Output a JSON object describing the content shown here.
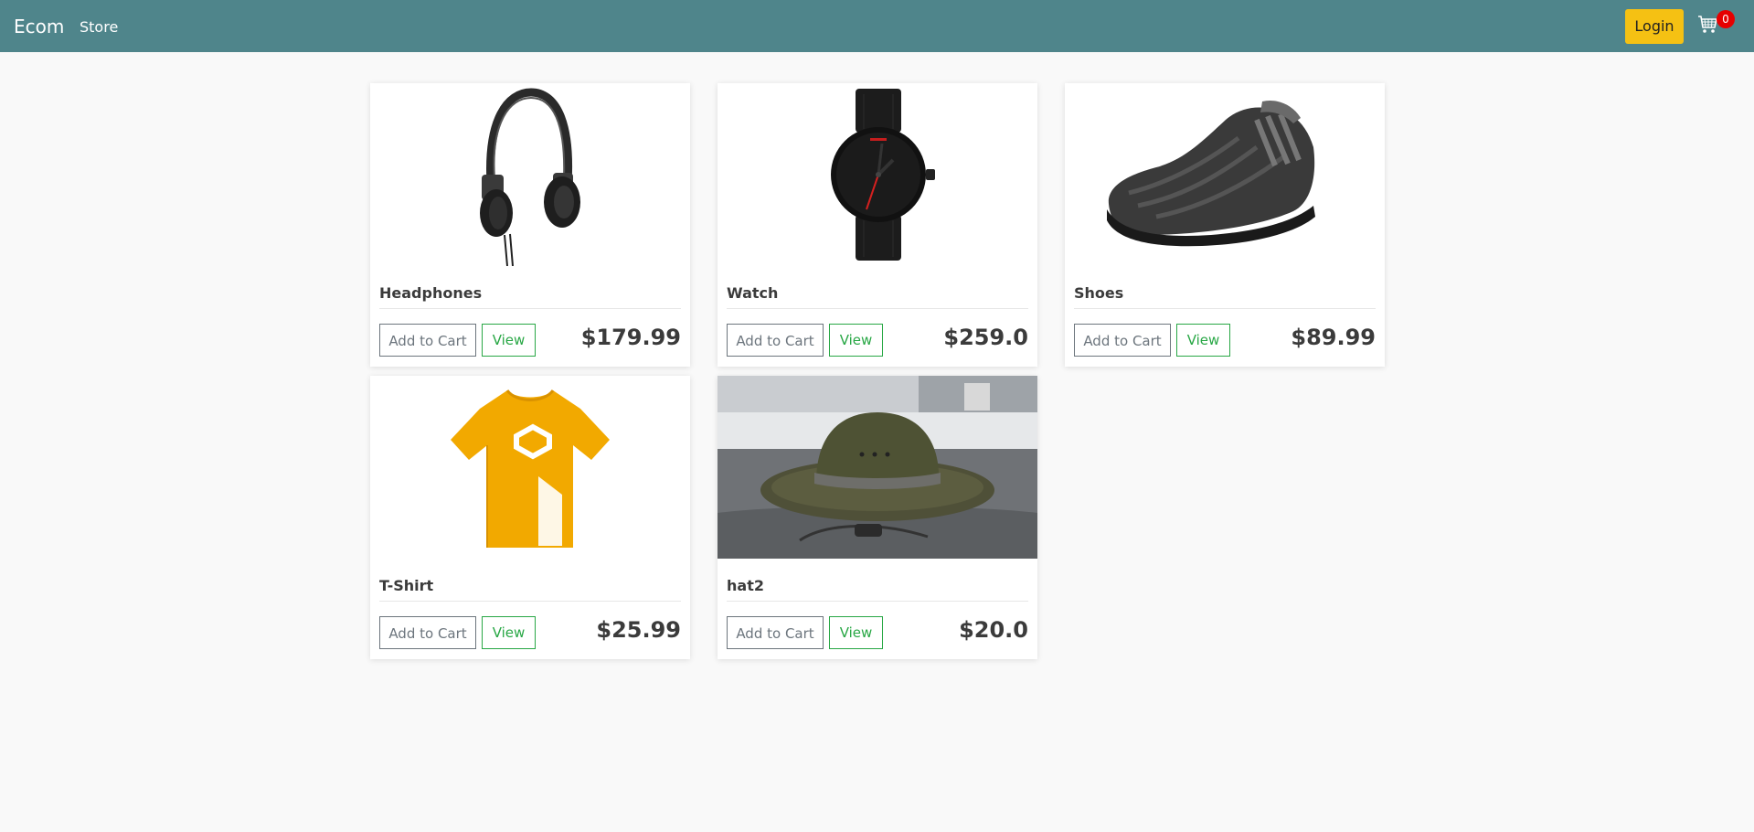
{
  "nav": {
    "brand": "Ecom",
    "store_link": "Store",
    "login_label": "Login",
    "cart_count": "0"
  },
  "colors": {
    "navbar": "#4f858b",
    "login_button": "#f5c113",
    "cart_badge": "#e60000",
    "view_button": "#28a745",
    "cart_button": "#6c757d"
  },
  "products": [
    {
      "name": "Headphones",
      "price": "$179.99",
      "image": "headphones-image",
      "add_label": "Add to Cart",
      "view_label": "View"
    },
    {
      "name": "Watch",
      "price": "$259.0",
      "image": "watch-image",
      "add_label": "Add to Cart",
      "view_label": "View"
    },
    {
      "name": "Shoes",
      "price": "$89.99",
      "image": "shoes-image",
      "add_label": "Add to Cart",
      "view_label": "View"
    },
    {
      "name": "T-Shirt",
      "price": "$25.99",
      "image": "tshirt-image",
      "add_label": "Add to Cart",
      "view_label": "View"
    },
    {
      "name": "hat2",
      "price": "$20.0",
      "image": "hat-image",
      "add_label": "Add to Cart",
      "view_label": "View"
    }
  ]
}
